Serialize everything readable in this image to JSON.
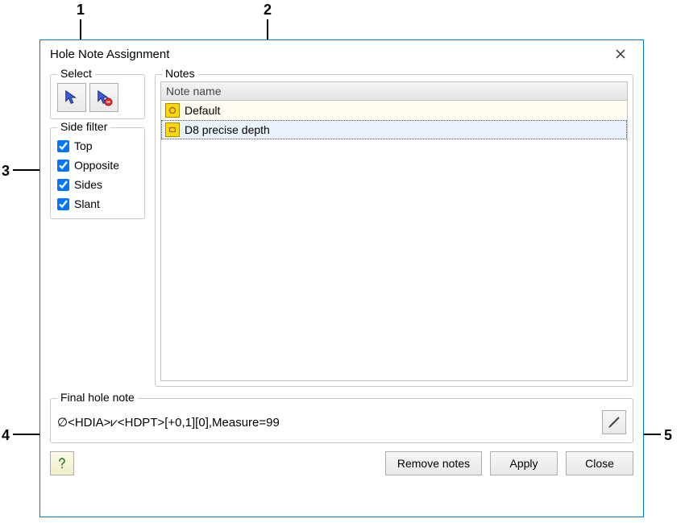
{
  "callouts": {
    "c1": "1",
    "c2": "2",
    "c3": "3",
    "c4": "4",
    "c5": "5"
  },
  "dialog": {
    "title": "Hole Note Assignment",
    "select_legend": "Select",
    "filter_legend": "Side filter",
    "notes_legend": "Notes",
    "final_legend": "Final hole note"
  },
  "filters": {
    "top": "Top",
    "opposite": "Opposite",
    "sides": "Sides",
    "slant": "Slant"
  },
  "notes": {
    "header": "Note name",
    "items": [
      {
        "label": "Default"
      },
      {
        "label": "D8 precise depth"
      }
    ]
  },
  "final": {
    "text": "∅<HDIA>⩗<HDPT>[+0,1][0],Measure=99"
  },
  "buttons": {
    "remove": "Remove notes",
    "apply": "Apply",
    "close": "Close"
  }
}
